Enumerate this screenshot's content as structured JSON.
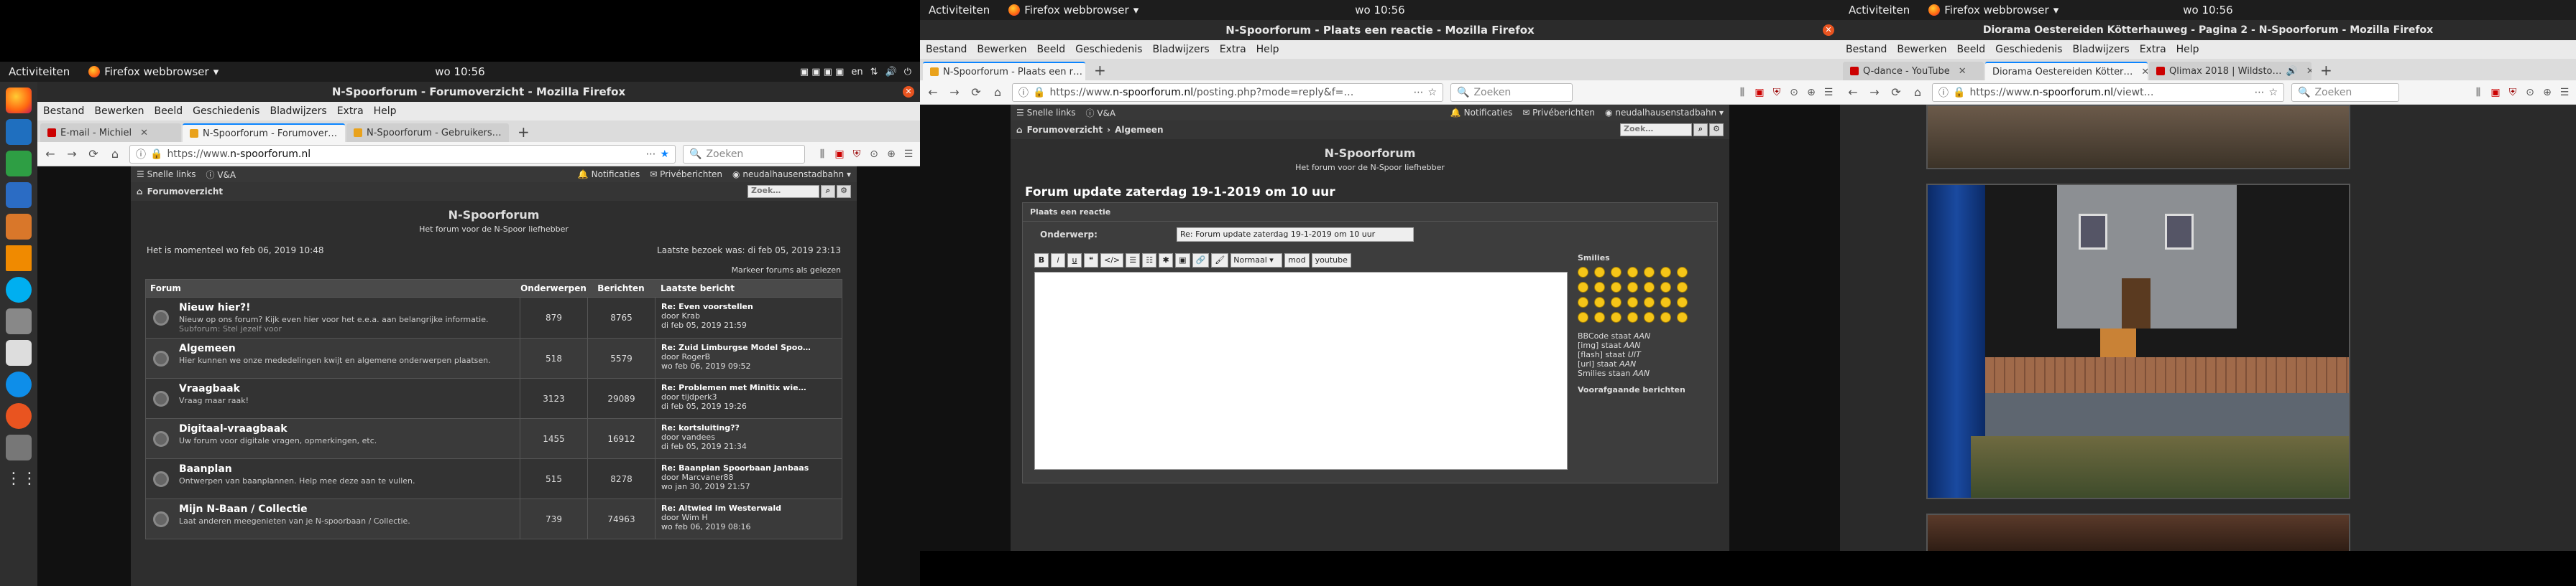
{
  "screens": {
    "s1": {
      "topbar": {
        "activities": "Activiteiten",
        "app": "Firefox webbrowser",
        "clock": "wo 10:56",
        "lang": "en"
      },
      "title": "N-Spoorforum - Forumoverzicht - Mozilla Firefox",
      "menu": [
        "Bestand",
        "Bewerken",
        "Beeld",
        "Geschiedenis",
        "Bladwijzers",
        "Extra",
        "Help"
      ],
      "tabs": [
        {
          "label": "E-mail - Michiel",
          "active": false
        },
        {
          "label": "N-Spoorforum - Forumover…",
          "active": true
        },
        {
          "label": "N-Spoorforum - Gebruikers…",
          "active": false
        }
      ],
      "url_prefix": "https://www.",
      "url_host": "n-spoorforum.nl",
      "search_placeholder": "Zoeken",
      "forum": {
        "quicklinks": "Snelle links",
        "faq": "V&A",
        "notifications": "Notificaties",
        "pm": "Privéberichten",
        "user": "neudalhausenstadbahn",
        "crumb": "Forumoverzicht",
        "search_placeholder": "Zoek…",
        "site_title": "N-Spoorforum",
        "site_desc": "Het forum voor de N-Spoor liefhebber",
        "now": "Het is momenteel wo feb 06, 2019 10:48",
        "last_visit": "Laatste bezoek was: di feb 05, 2019 23:13",
        "mark_read": "Markeer forums als gelezen",
        "headers": {
          "forum": "Forum",
          "topics": "Onderwerpen",
          "posts": "Berichten",
          "last": "Laatste bericht"
        },
        "rows": [
          {
            "title": "Nieuw hier?!",
            "desc": "Nieuw op ons forum? Kijk even hier voor het e.e.a. aan belangrijke informatie.",
            "sub": "Subforum: Stel jezelf voor",
            "topics": "879",
            "posts": "8765",
            "lt": "Re: Even voorstellen",
            "lb": "door Krab",
            "ld": "di feb 05, 2019 21:59"
          },
          {
            "title": "Algemeen",
            "desc": "Hier kunnen we onze mededelingen kwijt en algemene onderwerpen plaatsen.",
            "sub": "",
            "topics": "518",
            "posts": "5579",
            "lt": "Re: Zuid Limburgse Model Spoo…",
            "lb": "door RogerB",
            "ld": "wo feb 06, 2019 09:52"
          },
          {
            "title": "Vraagbaak",
            "desc": "Vraag maar raak!",
            "sub": "",
            "topics": "3123",
            "posts": "29089",
            "lt": "Re: Problemen met Minitix wie…",
            "lb": "door tijdperk3",
            "ld": "di feb 05, 2019 19:26"
          },
          {
            "title": "Digitaal-vraagbaak",
            "desc": "Uw forum voor digitale vragen, opmerkingen, etc.",
            "sub": "",
            "topics": "1455",
            "posts": "16912",
            "lt": "Re: kortsluiting??",
            "lb": "door vandees",
            "ld": "di feb 05, 2019 21:34"
          },
          {
            "title": "Baanplan",
            "desc": "Ontwerpen van baanplannen. Help mee deze aan te vullen.",
            "sub": "",
            "topics": "515",
            "posts": "8278",
            "lt": "Re: Baanplan Spoorbaan Janbaas",
            "lb": "door Marcvaner88",
            "ld": "wo jan 30, 2019 21:57"
          },
          {
            "title": "Mijn N-Baan / Collectie",
            "desc": "Laat anderen meegenieten van je N-spoorbaan / Collectie.",
            "sub": "",
            "topics": "739",
            "posts": "74963",
            "lt": "Re: Altwied im Westerwald",
            "lb": "door Wim H",
            "ld": "wo feb 06, 2019 08:16"
          }
        ]
      }
    },
    "s2": {
      "topbar": {
        "activities": "Activiteiten",
        "app": "Firefox webbrowser",
        "clock": "wo 10:56"
      },
      "title": "N-Spoorforum - Plaats een reactie - Mozilla Firefox",
      "menu": [
        "Bestand",
        "Bewerken",
        "Beeld",
        "Geschiedenis",
        "Bladwijzers",
        "Extra",
        "Help"
      ],
      "tabs": [
        {
          "label": "N-Spoorforum - Plaats een r…",
          "active": true
        }
      ],
      "url_prefix": "https://www.",
      "url_host": "n-spoorforum.nl",
      "url_path": "/posting.php?mode=reply&f=…",
      "search_placeholder": "Zoeken",
      "forum": {
        "quicklinks": "Snelle links",
        "faq": "V&A",
        "notifications": "Notificaties",
        "pm": "Privéberichten",
        "user": "neudalhausenstadbahn",
        "crumb1": "Forumoverzicht",
        "crumb2": "Algemeen",
        "search_placeholder": "Zoek…",
        "site_title": "N-Spoorforum",
        "site_desc": "Het forum voor de N-Spoor liefhebber",
        "topic_title": "Forum update zaterdag 19-1-2019 om 10 uur",
        "post_header": "Plaats een reactie",
        "subject_label": "Onderwerp:",
        "subject_value": "Re: Forum update zaterdag 19-1-2019 om 10 uur",
        "fmt_buttons": [
          "B",
          "i",
          "u",
          "❝",
          "</>",
          "☰",
          "☷",
          "✱",
          "▣",
          "🔗",
          "🖌"
        ],
        "font_size": "Normaal",
        "mod_btn": "mod",
        "yt_btn": "youtube",
        "smilies": "Smilies",
        "bb": [
          {
            "pre": "BBCode staat ",
            "val": "AAN"
          },
          {
            "pre": "[img] staat ",
            "val": "AAN"
          },
          {
            "pre": "[flash] staat ",
            "val": "UIT"
          },
          {
            "pre": "[url] staat ",
            "val": "AAN"
          },
          {
            "pre": "Smilies staan ",
            "val": "AAN"
          }
        ],
        "draft": "Voorafgaande berichten"
      }
    },
    "s3": {
      "topbar": {
        "activities": "Activiteiten",
        "app": "Firefox webbrowser",
        "clock": "wo 10:56"
      },
      "title": "Diorama Oestereiden Kötterhauweg - Pagina 2 - N-Spoorforum - Mozilla Firefox",
      "menu": [
        "Bestand",
        "Bewerken",
        "Beeld",
        "Geschiedenis",
        "Bladwijzers",
        "Extra",
        "Help"
      ],
      "tabs": [
        {
          "label": "Q-dance - YouTube",
          "active": false
        },
        {
          "label": "Diorama Oestereiden Kötter…",
          "active": true
        },
        {
          "label": "Qlimax 2018 | Wildsto…",
          "active": false
        }
      ],
      "url_prefix": "https://www.",
      "url_host": "n-spoorforum.nl",
      "url_path": "/viewt…",
      "search_placeholder": "Zoeken"
    }
  },
  "colors": {
    "accent": "#0a84ff",
    "ubuntu_orange": "#e95420",
    "forum_bg": "#2e2e2e"
  }
}
